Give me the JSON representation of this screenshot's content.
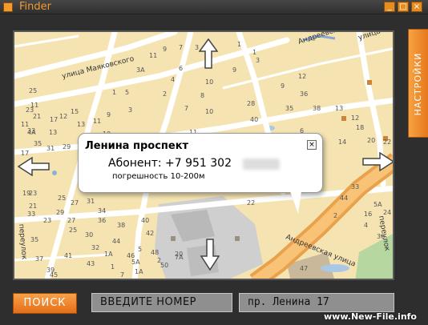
{
  "window": {
    "title": "Finder",
    "minimize_label": "_",
    "maximize_label": "□",
    "close_label": "×"
  },
  "map": {
    "streets": [
      "улица Маяковского",
      "Андреевская улица",
      "Андреевская улица",
      "переулок",
      "переулок",
      "улица"
    ],
    "house_numbers": [
      "3А",
      "11",
      "9",
      "7",
      "3",
      "1",
      "6",
      "4",
      "2",
      "1",
      "10",
      "8",
      "3",
      "9",
      "10",
      "11",
      "5",
      "1",
      "3",
      "9",
      "11",
      "13",
      "15",
      "12",
      "17",
      "21",
      "23",
      "25",
      "11",
      "19",
      "27",
      "29",
      "31",
      "35",
      "33",
      "11",
      "4А",
      "13",
      "17",
      "19",
      "21",
      "23",
      "25",
      "27",
      "30",
      "32",
      "34",
      "36",
      "38",
      "40",
      "42",
      "44",
      "46",
      "48",
      "50",
      "23",
      "25",
      "27",
      "29",
      "31",
      "33",
      "35",
      "37",
      "39",
      "41",
      "43",
      "45",
      "47",
      "22",
      "2",
      "7А",
      "5А",
      "1А",
      "1",
      "7",
      "9",
      "36",
      "35",
      "38",
      "40",
      "2",
      "6",
      "13",
      "12",
      "14",
      "18",
      "20",
      "22",
      "24",
      "36",
      "33",
      "44",
      "2",
      "4",
      "12",
      "28",
      "20",
      "5А",
      "16",
      "14",
      "1",
      "3",
      "5",
      "1А",
      "7",
      "9"
    ]
  },
  "popup": {
    "title": "Ленина проспект",
    "subscriber": "Абонент: +7 951 302",
    "accuracy": "погрешность 10-200м",
    "close_label": "×"
  },
  "settings": {
    "label": "НАСТРОЙКИ"
  },
  "controls": {
    "search_label": "ПОИСК",
    "number_placeholder": "ВВЕДИТЕ НОМЕР",
    "address_value": "пр. Ленина 17"
  },
  "watermark": "www.New-File.info",
  "colors": {
    "accent": "#e58d22",
    "map_background": "#f5e4b2",
    "road_major": "#f4a64a",
    "road_minor": "#ffffff"
  }
}
